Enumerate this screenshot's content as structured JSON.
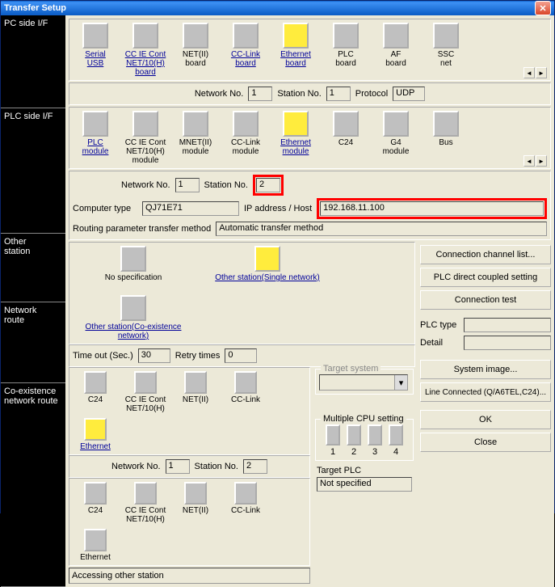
{
  "title": "Transfer Setup",
  "sections": {
    "pc_side": "PC side I/F",
    "plc_side": "PLC side I/F",
    "other_station": "Other\nstation",
    "network_route": "Network\nroute",
    "coexistence": "Co-existence\nnetwork route"
  },
  "pc_icons": [
    {
      "label": "Serial\nUSB",
      "link": true
    },
    {
      "label": "CC IE Cont\nNET/10(H)\nboard",
      "link": true
    },
    {
      "label": "NET(II)\nboard"
    },
    {
      "label": "CC-Link\nboard",
      "link": true
    },
    {
      "label": "Ethernet\nboard",
      "link": true,
      "sel": true
    },
    {
      "label": "PLC\nboard"
    },
    {
      "label": "AF\nboard"
    },
    {
      "label": "SSC\nnet"
    }
  ],
  "pc_params": {
    "network_no_label": "Network No.",
    "network_no": "1",
    "station_no_label": "Station No.",
    "station_no": "1",
    "protocol_label": "Protocol",
    "protocol": "UDP"
  },
  "plc_icons": [
    {
      "label": "PLC\nmodule",
      "link": true
    },
    {
      "label": "CC IE Cont\nNET/10(H)\nmodule"
    },
    {
      "label": "MNET(II)\nmodule"
    },
    {
      "label": "CC-Link\nmodule"
    },
    {
      "label": "Ethernet\nmodule",
      "link": true,
      "sel": true
    },
    {
      "label": "C24"
    },
    {
      "label": "G4\nmodule"
    },
    {
      "label": "Bus"
    }
  ],
  "plc_params": {
    "network_no_label": "Network No.",
    "network_no": "1",
    "station_no_label": "Station No.",
    "station_no": "2",
    "computer_type_label": "Computer type",
    "computer_type": "QJ71E71",
    "ip_label": "IP address / Host",
    "ip": "192.168.11.100",
    "routing_label": "Routing parameter transfer method",
    "routing_value": "Automatic transfer method"
  },
  "other_icons": [
    {
      "label": "No specification"
    },
    {
      "label": "Other station(Single network)",
      "link": true,
      "sel": true
    },
    {
      "label": "Other station(Co-existence network)",
      "link": true
    }
  ],
  "other_params": {
    "timeout_label": "Time out (Sec.)",
    "timeout": "30",
    "retry_label": "Retry times",
    "retry": "0"
  },
  "net_icons": [
    {
      "label": "C24"
    },
    {
      "label": "CC IE Cont\nNET/10(H)"
    },
    {
      "label": "NET(II)"
    },
    {
      "label": "CC-Link"
    },
    {
      "label": "Ethernet",
      "link": true,
      "sel": true
    }
  ],
  "net_params": {
    "network_no_label": "Network No.",
    "network_no": "1",
    "station_no_label": "Station No.",
    "station_no": "2"
  },
  "coex_icons": [
    {
      "label": "C24"
    },
    {
      "label": "CC IE Cont\nNET/10(H)"
    },
    {
      "label": "NET(II)"
    },
    {
      "label": "CC-Link"
    },
    {
      "label": "Ethernet"
    }
  ],
  "access_status": "Accessing other station",
  "target_system_label": "Target system",
  "multi_cpu_label": "Multiple CPU setting",
  "cpu_labels": [
    "1",
    "2",
    "3",
    "4"
  ],
  "target_plc_label": "Target PLC",
  "target_plc_value": "Not specified",
  "plc_type_label": "PLC type",
  "detail_label": "Detail",
  "buttons": {
    "conn_list": "Connection channel list...",
    "direct": "PLC direct coupled setting",
    "conn_test": "Connection test",
    "sys_image": "System image...",
    "line_conn": "Line Connected (Q/A6TEL,C24)...",
    "ok": "OK",
    "close": "Close"
  }
}
